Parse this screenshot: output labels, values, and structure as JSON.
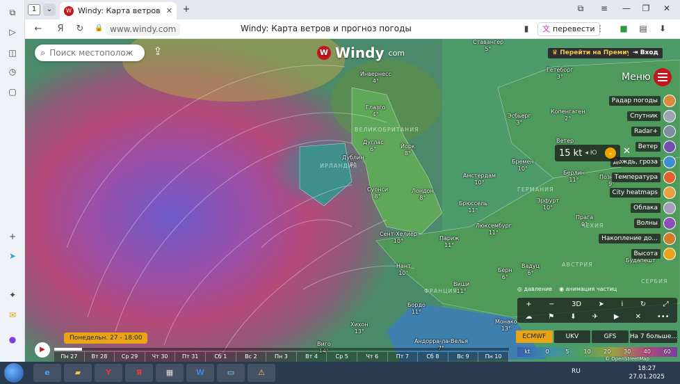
{
  "browser": {
    "tab_count": "1",
    "tab_title": "Windy: Карта ветров и",
    "url": "www.windy.com",
    "page_title": "Windy: Карта ветров и прогноз погоды",
    "translate_label": "перевести"
  },
  "windy": {
    "search_placeholder": "Поиск местоположен",
    "logo_text": "Windy",
    "logo_suffix": "com",
    "premium_label": "Перейти на Премиум",
    "login_label": "Вход",
    "menu_label": "Меню",
    "layers": [
      {
        "label": "Радар погоды",
        "color": "#d98a3a"
      },
      {
        "label": "Спутник",
        "color": "#9aa6b2"
      },
      {
        "label": "Radar+",
        "color": "#7b8ea3"
      },
      {
        "label": "Ветер",
        "color": "#6f4fb0"
      },
      {
        "label": "Дождь, гроза",
        "color": "#3f8fd0"
      },
      {
        "label": "Температура",
        "color": "#e0612a"
      },
      {
        "label": "City heatmaps",
        "color": "#e6a040"
      },
      {
        "label": "Облака",
        "color": "#a0a0b8"
      },
      {
        "label": "Волны",
        "color": "#8a4fb8"
      },
      {
        "label": "Накопление до...",
        "color": "#d07d2a"
      },
      {
        "label": "Высота",
        "color": "#e8a317"
      }
    ],
    "wind_value": "15 kt",
    "wind_dir": "Ю",
    "overlay_pressure": "давление",
    "overlay_animation": "анимация частиц",
    "controls_row1": [
      "+",
      "−",
      "3D",
      "➤",
      "i",
      "↻",
      "⤢"
    ],
    "controls_row2": [
      "☁",
      "⚑",
      "⬇",
      "✈",
      "▶",
      "✕",
      "•••"
    ],
    "models": [
      {
        "label": "ECMWF",
        "active": true
      },
      {
        "label": "UKV",
        "active": false
      },
      {
        "label": "GFS",
        "active": false
      },
      {
        "label": "На 7 больше...",
        "active": false
      }
    ],
    "legend": [
      "kt",
      "0",
      "5",
      "10",
      "20",
      "30",
      "40",
      "60"
    ],
    "attribution": "© OpenStreetMap contributors",
    "date_badge": "Понедельн. 27 - 18:00",
    "days": [
      "Пн 27",
      "Вт 28",
      "Ср 29",
      "Чт 30",
      "Пт 31",
      "Сб 1",
      "Вс 2",
      "Пн 3",
      "Вт 4",
      "Ср 5",
      "Чт 6",
      "Пт 7",
      "Сб 8",
      "Вс 9",
      "Пн 10"
    ],
    "cities": [
      {
        "name": "Ставангер",
        "temp": "5°"
      },
      {
        "name": "Инвернесс",
        "temp": "4°"
      },
      {
        "name": "Гетеборг",
        "temp": "3°"
      },
      {
        "name": "Глазго",
        "temp": "4°"
      },
      {
        "name": "Эсбьерг",
        "temp": "3°"
      },
      {
        "name": "Копенгаген",
        "temp": "2°"
      },
      {
        "name": "Дуглас",
        "temp": "6°"
      },
      {
        "name": "Йорк",
        "temp": "8°"
      },
      {
        "name": "Ветер",
        "temp": ""
      },
      {
        "name": "Дублин",
        "temp": "8°"
      },
      {
        "name": "Бремен",
        "temp": "10°"
      },
      {
        "name": "Берлин",
        "temp": "11°"
      },
      {
        "name": "Амстердам",
        "temp": "10°"
      },
      {
        "name": "Суонси",
        "temp": "8°"
      },
      {
        "name": "Лондон",
        "temp": "8°"
      },
      {
        "name": "Брюссель",
        "temp": "11°"
      },
      {
        "name": "Эрфурт",
        "temp": "10°"
      },
      {
        "name": "Познань",
        "temp": "9°"
      },
      {
        "name": "Люксембург",
        "temp": "11°"
      },
      {
        "name": "Сент-Хелиер",
        "temp": "10°"
      },
      {
        "name": "Прага",
        "temp": "9°"
      },
      {
        "name": "Париж",
        "temp": "11°"
      },
      {
        "name": "Нант",
        "temp": "10°"
      },
      {
        "name": "Берн",
        "temp": "6°"
      },
      {
        "name": "Вадуц",
        "temp": "6°"
      },
      {
        "name": "Будапешт",
        "temp": ""
      },
      {
        "name": "Виши",
        "temp": "11°"
      },
      {
        "name": "Бордо",
        "temp": "11°"
      },
      {
        "name": "Монако",
        "temp": "13°"
      },
      {
        "name": "Хихон",
        "temp": "13°"
      },
      {
        "name": "Андорра-ла-Велья",
        "temp": "7°"
      },
      {
        "name": "Виго",
        "temp": "14°"
      }
    ],
    "countries": [
      "ВЕЛИКОБРИТАНИЯ",
      "ИРЛАНДИЯ",
      "ГЕРМАНИЯ",
      "ЧЕХИЯ",
      "АВСТРИЯ",
      "ФРАНЦИЯ",
      "СЕРБИЯ"
    ]
  },
  "taskbar": {
    "lang": "RU",
    "time": "18:27",
    "date": "27.01.2025"
  }
}
